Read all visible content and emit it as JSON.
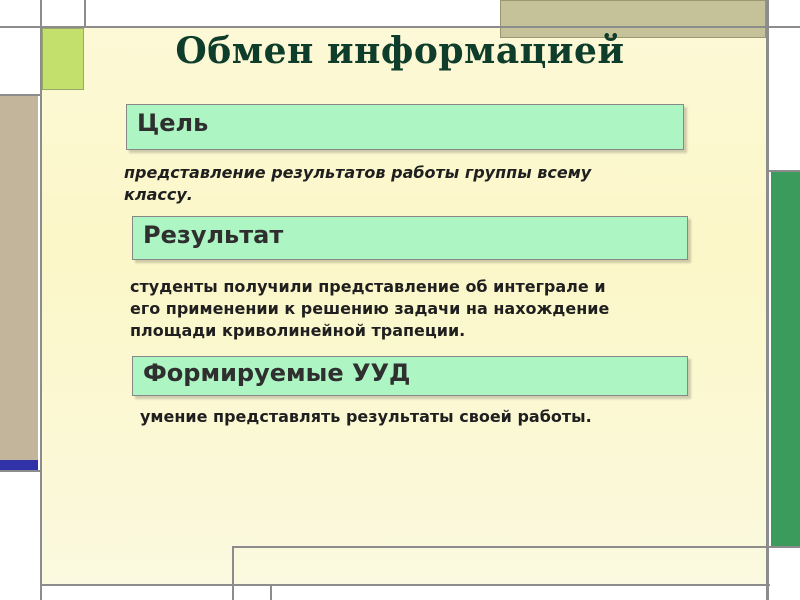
{
  "slide": {
    "title": "Обмен информацией",
    "sections": [
      {
        "heading": "Цель",
        "text_lines": [
          "представление результатов работы группы всему",
          "классу."
        ]
      },
      {
        "heading": "Результат",
        "text_lines": [
          "студенты получили представление об интеграле и",
          "его применении к решению задачи на нахождение",
          "площади криволинейной трапеции."
        ]
      },
      {
        "heading": "Формируемые УУД",
        "text_lines": [
          "умение представлять результаты своей работы."
        ]
      }
    ]
  },
  "colors": {
    "heading_box": "#adf5c3",
    "title_text": "#0f3d2b",
    "accent_green": "#3b9b5c",
    "accent_lime": "#c2e06b",
    "accent_khaki": "#c5c29a",
    "accent_taupe": "#c2b59c",
    "accent_navy": "#3232a8"
  }
}
